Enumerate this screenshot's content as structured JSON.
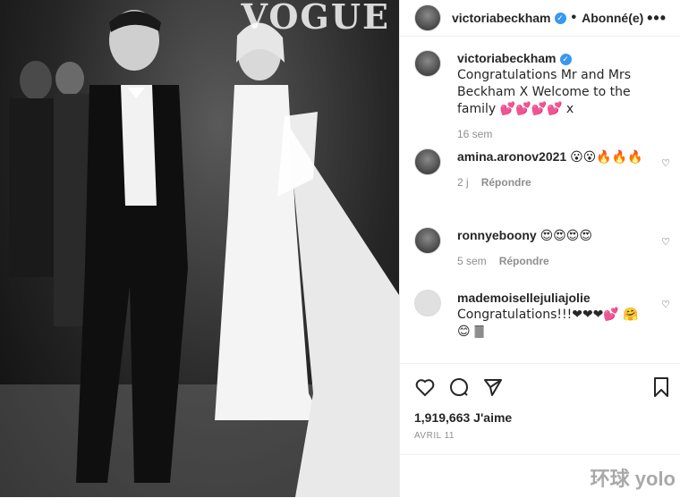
{
  "photo": {
    "overlay_text": "VOGUE"
  },
  "header": {
    "username": "victoriabeckham",
    "separator": "•",
    "follow_label": "Abonné(e)",
    "more": "•••"
  },
  "comments": [
    {
      "username": "victoriabeckham",
      "text": "Congratulations Mr and Mrs Beckham X Welcome to the family 💕💕💕💕 x",
      "time": "16 sem",
      "verified": true
    },
    {
      "username": "amina.aronov2021",
      "text": "😮😮🔥🔥🔥",
      "time": "2 j",
      "reply": "Répondre"
    },
    {
      "username": "ronnyeboony",
      "text": "😍😍😍😍",
      "time": "5 sem",
      "reply": "Répondre"
    },
    {
      "username": "mademoisellejuliajolie",
      "text": "Congratulations!!!❤❤❤💕 🤗😊 🀫"
    }
  ],
  "likes": "1,919,663 J'aime",
  "date": "AVRIL 11",
  "watermark": "环球 yolo",
  "icons": [
    "heart-icon",
    "comment-icon",
    "share-icon",
    "bookmark-icon"
  ],
  "colors": {
    "verified": "#3897f0",
    "muted": "#8e8e8e",
    "text": "#262626"
  }
}
